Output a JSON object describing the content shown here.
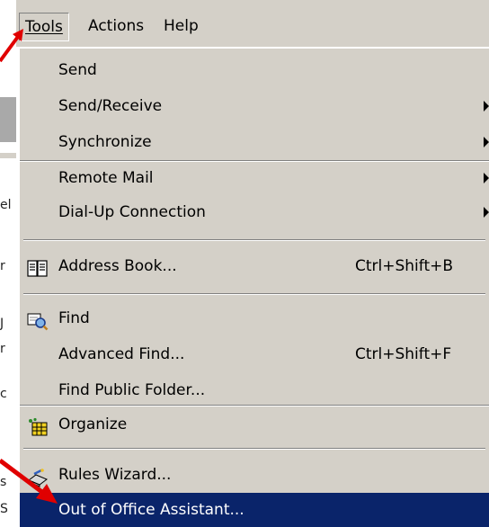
{
  "menubar": {
    "items": [
      {
        "label": "Tools",
        "open": true
      },
      {
        "label": "Actions",
        "open": false
      },
      {
        "label": "Help",
        "open": false
      }
    ]
  },
  "menu": {
    "items": [
      {
        "label": "Send"
      },
      {
        "label": "Send/Receive",
        "submenu": true
      },
      {
        "label": "Synchronize",
        "submenu": true
      },
      {
        "label": "Remote Mail",
        "submenu": true
      },
      {
        "label": "Dial-Up Connection",
        "submenu": true
      },
      {
        "label": "Address Book...",
        "shortcut": "Ctrl+Shift+B",
        "icon": "address-book-icon"
      },
      {
        "label": "Find",
        "icon": "find-icon"
      },
      {
        "label": "Advanced Find...",
        "shortcut": "Ctrl+Shift+F"
      },
      {
        "label": "Find Public Folder..."
      },
      {
        "label": "Organize",
        "icon": "organize-icon"
      },
      {
        "label": "Rules Wizard...",
        "icon": "rules-wizard-icon"
      },
      {
        "label": "Out of Office Assistant...",
        "selected": true
      }
    ]
  },
  "colors": {
    "menu_bg": "#d4d0c8",
    "selection": "#0a246a",
    "annotation_arrow": "#e00000"
  },
  "left_fragments": [
    "el",
    "r",
    "J",
    "r",
    "c",
    "s",
    "S"
  ]
}
